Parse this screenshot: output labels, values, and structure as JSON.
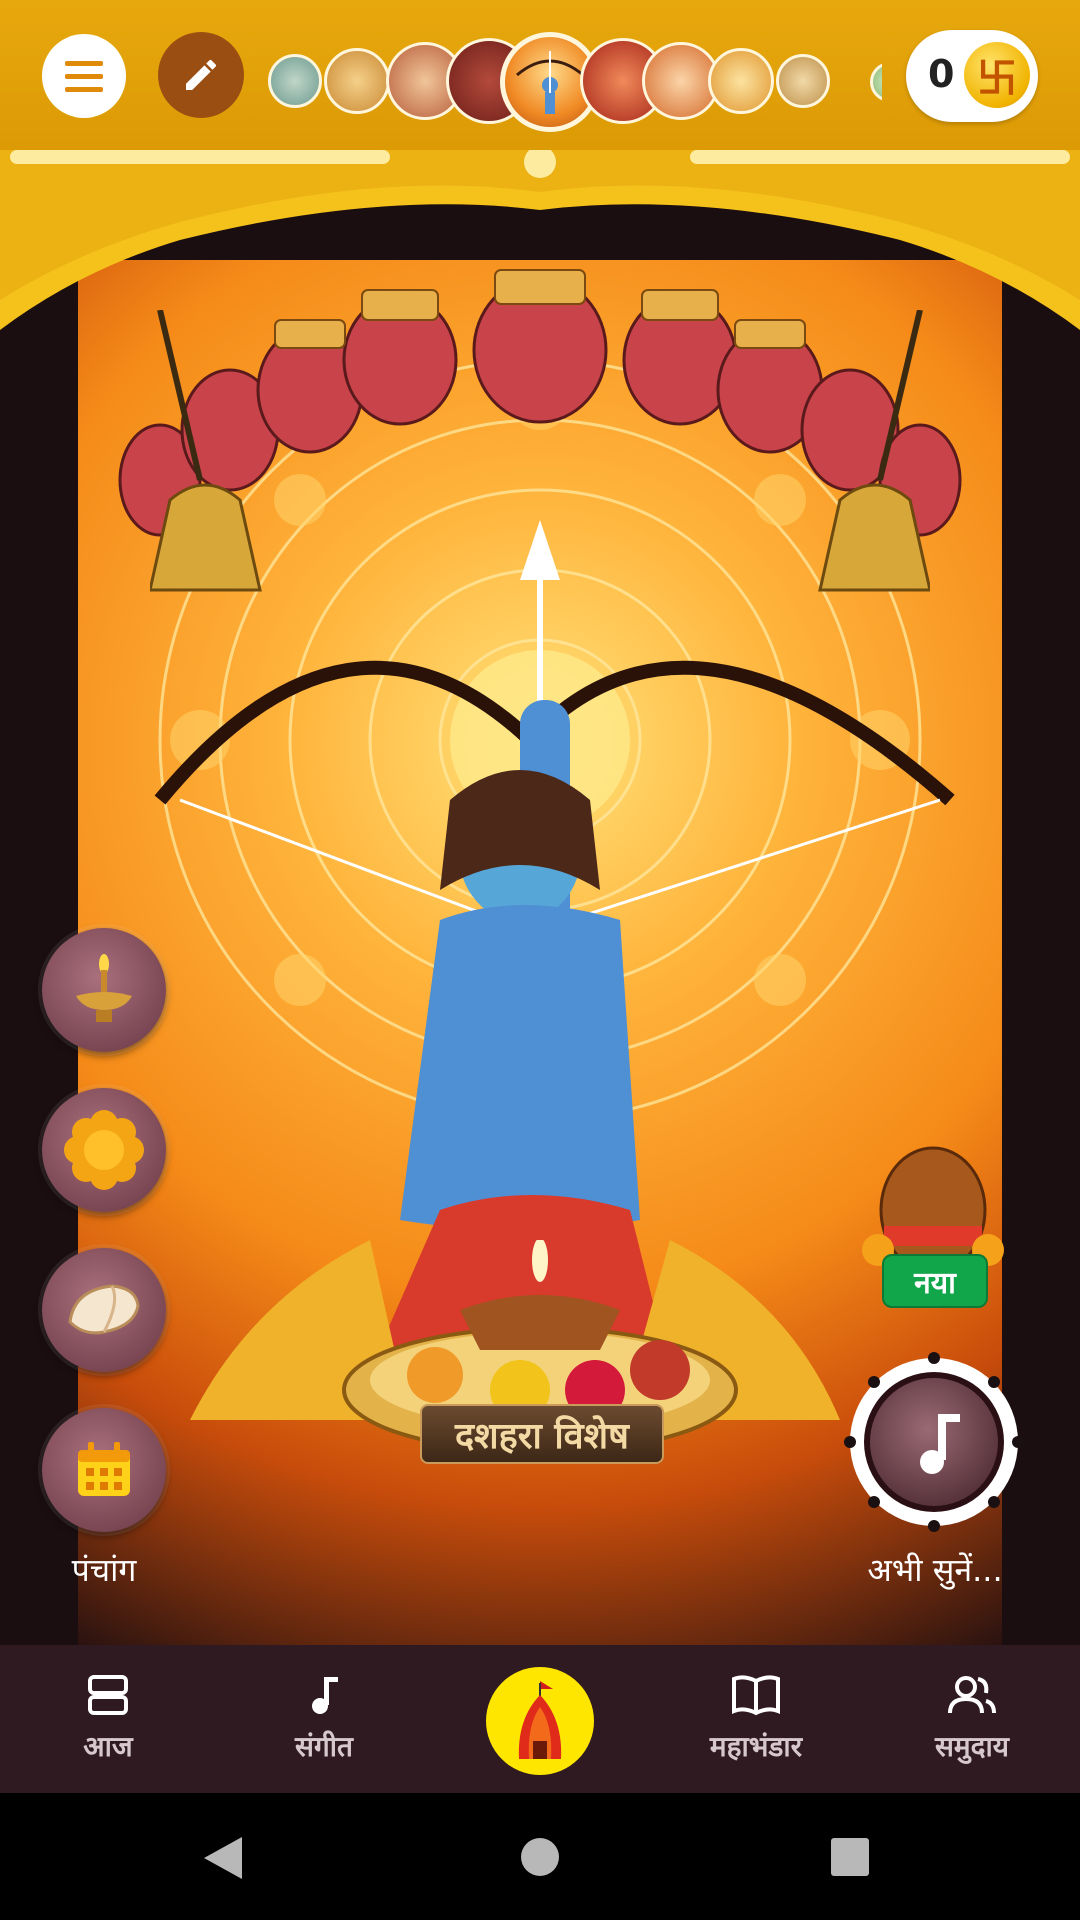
{
  "topbar": {
    "menu_icon": "hamburger-icon",
    "edit_icon": "pencil-icon",
    "coin_count": "0",
    "coin_icon": "swastik-coin-icon",
    "deities": [
      {
        "name": "deity-shiva",
        "color": "#7fa6a0"
      },
      {
        "name": "deity-durga",
        "color": "#d9a24c"
      },
      {
        "name": "deity-ramdev",
        "color": "#c96b44"
      },
      {
        "name": "deity-tulsi-scripture",
        "color": "#8b2a22"
      },
      {
        "name": "deity-rama-selected",
        "color": "#f0a23a"
      },
      {
        "name": "deity-maa-durga",
        "color": "#c23c2c"
      },
      {
        "name": "deity-hanuman",
        "color": "#e07a3a"
      },
      {
        "name": "deity-ganesha",
        "color": "#e8a73a"
      },
      {
        "name": "deity-vishnu",
        "color": "#cfa058"
      },
      {
        "name": "deity-more",
        "color": "#9bc48c"
      }
    ]
  },
  "art": {
    "banner_text": "दशहरा विशेष",
    "new_badge": "नया"
  },
  "side_buttons": [
    {
      "name": "diya-lamp-button",
      "icon": "oil-lamp-icon"
    },
    {
      "name": "flower-offering-button",
      "icon": "marigold-icon"
    },
    {
      "name": "conch-button",
      "icon": "conch-shell-icon"
    },
    {
      "name": "panchang-button",
      "icon": "calendar-icon"
    }
  ],
  "panchang_label": "पंचांग",
  "music_label": "अभी सुनें...",
  "bottom_nav": [
    {
      "label": "आज",
      "icon": "today-cards-icon"
    },
    {
      "label": "संगीत",
      "icon": "music-note-icon"
    },
    {
      "label": "",
      "icon": "temple-icon"
    },
    {
      "label": "महाभंडार",
      "icon": "open-book-icon"
    },
    {
      "label": "समुदाय",
      "icon": "community-icon"
    }
  ],
  "colors": {
    "topbar": "#e0a00a",
    "nav_bg": "#2e1a20",
    "center_button": "#ffe600",
    "new_badge": "#11a64a"
  }
}
